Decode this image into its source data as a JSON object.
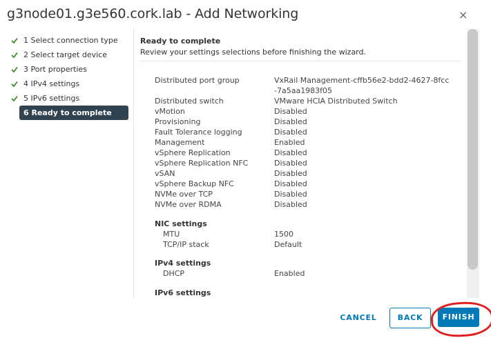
{
  "window": {
    "title": "g3node01.g3e560.cork.lab - Add Networking",
    "close_glyph": "×"
  },
  "steps": [
    {
      "label": "1 Select connection type",
      "status": "complete"
    },
    {
      "label": "2 Select target device",
      "status": "complete"
    },
    {
      "label": "3 Port properties",
      "status": "complete"
    },
    {
      "label": "4 IPv4 settings",
      "status": "complete"
    },
    {
      "label": "5 IPv6 settings",
      "status": "complete"
    },
    {
      "label": "6 Ready to complete",
      "status": "active"
    }
  ],
  "content": {
    "heading": "Ready to complete",
    "subheading": "Review your settings selections before finishing the wizard.",
    "settings": [
      {
        "key": "Distributed port group",
        "value": "VxRail Management-cffb56e2-bdd2-4627-8fcc-7a5aa1983f05"
      },
      {
        "key": "Distributed switch",
        "value": "VMware HCIA Distributed Switch"
      },
      {
        "key": "vMotion",
        "value": "Disabled"
      },
      {
        "key": "Provisioning",
        "value": "Disabled"
      },
      {
        "key": "Fault Tolerance logging",
        "value": "Disabled"
      },
      {
        "key": "Management",
        "value": "Enabled"
      },
      {
        "key": "vSphere Replication",
        "value": "Disabled"
      },
      {
        "key": "vSphere Replication NFC",
        "value": "Disabled"
      },
      {
        "key": "vSAN",
        "value": "Disabled"
      },
      {
        "key": "vSphere Backup NFC",
        "value": "Disabled"
      },
      {
        "key": "NVMe over TCP",
        "value": "Disabled"
      },
      {
        "key": "NVMe over RDMA",
        "value": "Disabled"
      }
    ],
    "nic_settings": {
      "title": "NIC settings",
      "mtu_label": "MTU",
      "mtu_value": "1500",
      "stack_label": "TCP/IP stack",
      "stack_value": "Default"
    },
    "ipv4_settings": {
      "title": "IPv4 settings",
      "dhcp_label": "DHCP",
      "dhcp_value": "Enabled"
    },
    "ipv6_settings": {
      "title": "IPv6 settings"
    }
  },
  "footer": {
    "cancel_label": "CANCEL",
    "back_label": "BACK",
    "finish_label": "FINISH"
  },
  "colors": {
    "accent": "#0079b8",
    "active_step_bg": "#314351",
    "check": "#3a8a2a",
    "annotation": "#e02020"
  }
}
